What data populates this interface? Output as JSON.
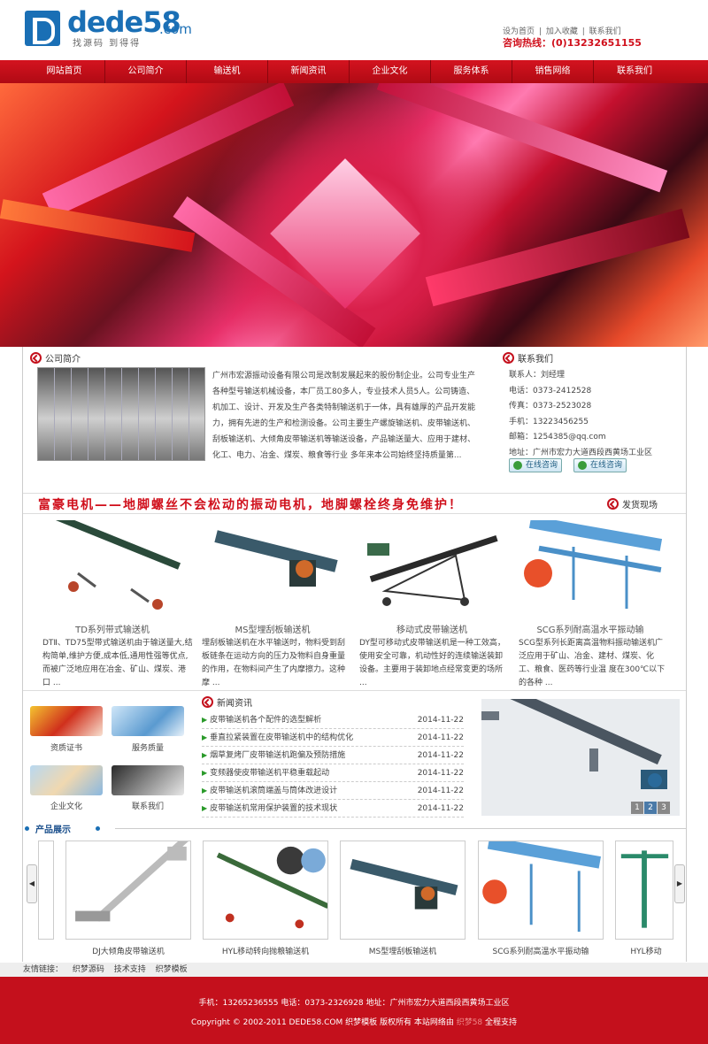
{
  "header": {
    "logo_word": "dede58",
    "logo_com": ".com",
    "logo_slogan": "找源码 到得得",
    "top_links": [
      "设为首页",
      "|",
      "加入收藏",
      "|",
      "联系我们"
    ],
    "hotline": "咨询热线：(0)13232651155"
  },
  "nav": [
    "网站首页",
    "公司简介",
    "输送机",
    "新闻资讯",
    "企业文化",
    "服务体系",
    "销售网络",
    "联系我们"
  ],
  "about": {
    "title": "公司简介",
    "text": "广州市宏源振动设备有限公司是改制发展起来的股份制企业。公司专业生产各种型号输送机械设备，本厂员工80多人，专业技术人员5人。公司铸造、机加工、设计、开发及生产各类特制输送机于一体，具有雄厚的产品开发能力，拥有先进的生产和检测设备。公司主要生产螺旋输送机、皮带输送机、刮板输送机、大倾角皮带输送机等输送设备，产品输送量大、应用于建材、化工、电力、冶金、煤炭、粮食等行业 多年来本公司始终坚持质量第..."
  },
  "contact": {
    "title": "联系我们",
    "lines": [
      "联系人：刘经理",
      "电话：0373-2412528",
      "传真：0373-2523028",
      "手机：13223456255",
      "邮箱：1254385@qq.com",
      "地址：广州市宏力大道西段西黄场工业区"
    ],
    "qq1": "在线咨询",
    "qq2": "在线咨询"
  },
  "slogan": "富豪电机——地脚螺丝不会松动的振动电机，地脚螺栓终身免维护！",
  "fahuo": "发货现场",
  "products": [
    {
      "name": "TD系列带式输送机",
      "desc": "DTⅡ、TD75型带式输送机由于输送量大,结构简单,维护方便,成本低,通用性强等优点,而被广泛地应用在冶金、矿山、煤炭、港口 ..."
    },
    {
      "name": "MS型埋刮板输送机",
      "desc": "埋刮板输送机在水平输送时，物料受到刮板链条在运动方向的压力及物料自身重量的作用，在物料间产生了内摩擦力。这种摩 ..."
    },
    {
      "name": "移动式皮带输送机",
      "desc": "DY型可移动式皮带输送机是一种工效高，使用安全可靠，机动性好的连续输送装卸设备。主要用于装卸地点经常变更的场所 ..."
    },
    {
      "name": "SCG系列耐高温水平振动输",
      "desc": "SCG型系列长距离高温物料振动输送机广泛应用于矿山、冶金、建材、煤炭、化工、粮食、医药等行业温 度在300℃以下的各种 ..."
    }
  ],
  "tiles": [
    "资质证书",
    "服务质量",
    "企业文化",
    "联系我们"
  ],
  "news": {
    "title": "新闻资讯",
    "items": [
      {
        "title": "皮带输送机各个配件的选型解析",
        "date": "2014-11-22"
      },
      {
        "title": "垂直拉紧装置在皮带输送机中的结构优化",
        "date": "2014-11-22"
      },
      {
        "title": "烟草复烤厂皮带输送机跑偏及预防措施",
        "date": "2014-11-22"
      },
      {
        "title": "变频器使皮带输送机平稳重载起动",
        "date": "2014-11-22"
      },
      {
        "title": "皮带输送机滚筒端盖与筒体改进设计",
        "date": "2014-11-22"
      },
      {
        "title": "皮带输送机常用保护装置的技术现状",
        "date": "2014-11-22"
      }
    ]
  },
  "pager": [
    "1",
    "2",
    "3"
  ],
  "show": {
    "title": "产品展示",
    "items": [
      "DJ大倾角皮带输送机",
      "HYL移动转向抛粮输送机",
      "MS型埋刮板输送机",
      "SCG系列耐高温水平振动输",
      "HYL移动"
    ]
  },
  "friend": {
    "label": "友情链接：",
    "links": [
      "织梦源码",
      "技术支持",
      "织梦模板"
    ]
  },
  "footer": {
    "line1": "手机：13265236555 电话：0373-2326928 地址：广州市宏力大道西段西黄场工业区",
    "line2a": "Copyright © 2002-2011 DEDE58.COM 织梦模板 版权所有 本站网络由",
    "line2b": "织梦58",
    "line2c": "全程支持"
  },
  "colors": {
    "brand_red": "#c4101c",
    "brand_blue": "#1a6fb5"
  }
}
